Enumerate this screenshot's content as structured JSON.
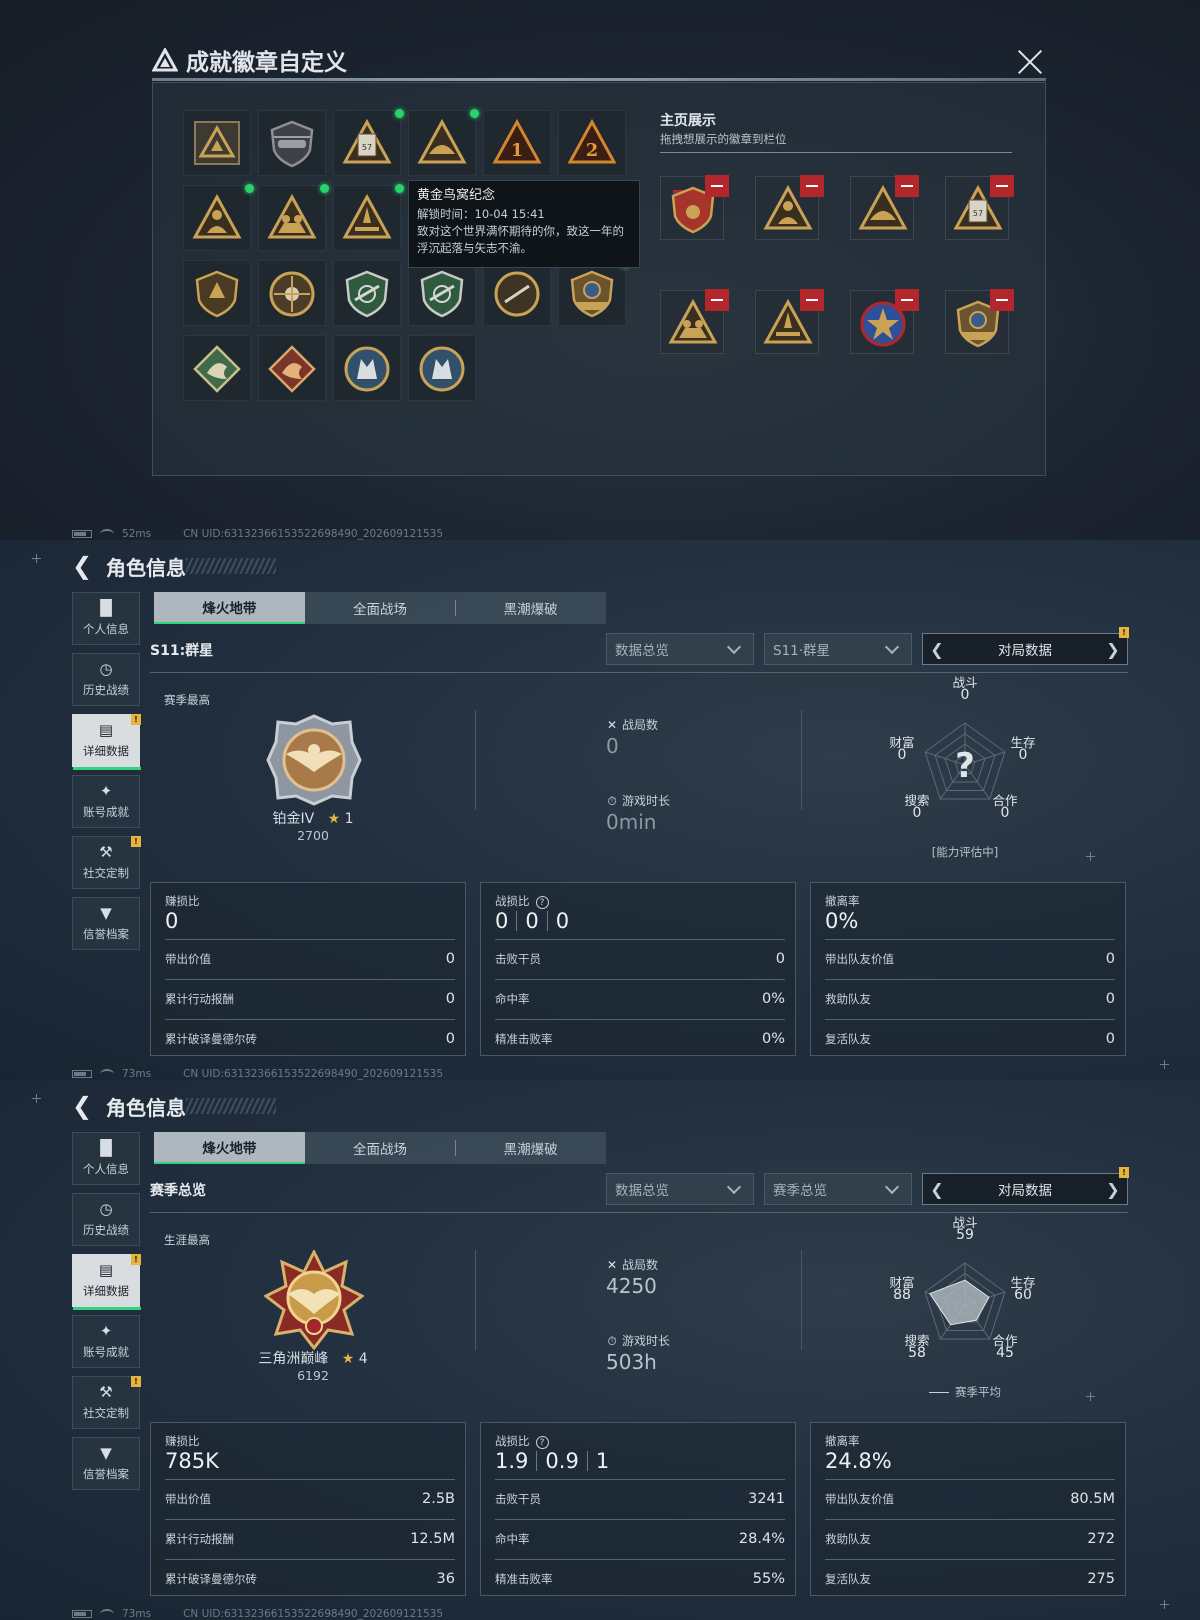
{
  "dialog": {
    "title": "成就徽章自定义",
    "tooltip": {
      "title": "黄金鸟窝纪念",
      "unlock": "解锁时间：10-04 15:41",
      "desc": "致对这个世界满怀期待的你，致这一年的浮沉起落与矢志不渝。"
    },
    "showcase_title": "主页展示",
    "showcase_sub": "拖拽想展示的徽章到栏位",
    "badges": [
      {
        "icon": "triangle-emblem-icon",
        "new": false
      },
      {
        "icon": "helicopter-badge-icon",
        "new": false
      },
      {
        "icon": "canister-badge-icon",
        "new": true,
        "text": "57"
      },
      {
        "icon": "helmet-badge-icon",
        "new": true
      },
      {
        "icon": "number-one-badge-icon",
        "new": false,
        "text": "1"
      },
      {
        "icon": "number-two-badge-icon",
        "new": false,
        "text": "2"
      },
      {
        "icon": "soldier-badge-icon",
        "new": true
      },
      {
        "icon": "squad-badge-icon",
        "new": true
      },
      {
        "icon": "rocket-badge-icon",
        "new": true
      },
      {
        "icon": "hidden-badge-icon",
        "new": false
      },
      {
        "icon": "hidden-badge-icon",
        "new": false
      },
      {
        "icon": "hidden-badge-icon",
        "new": true
      },
      {
        "icon": "shield-badge-icon",
        "new": false
      },
      {
        "icon": "skull-crosshair-badge-icon",
        "new": false
      },
      {
        "icon": "green-rifle-shield-icon",
        "new": false
      },
      {
        "icon": "green-rifle-shield-icon",
        "new": false
      },
      {
        "icon": "rifle-target-badge-icon",
        "new": false
      },
      {
        "icon": "golden-nest-badge-icon",
        "new": true
      },
      {
        "icon": "green-dragon-badge-icon",
        "new": false
      },
      {
        "icon": "red-dragon-badge-icon",
        "new": false
      },
      {
        "icon": "blue-wolf-badge-icon",
        "new": false
      },
      {
        "icon": "blue-wolf-badge-icon",
        "new": false
      }
    ],
    "showcase": [
      {
        "icon": "flag-shield-badge-icon"
      },
      {
        "icon": "soldier-badge-icon"
      },
      {
        "icon": "helmet-badge-icon"
      },
      {
        "icon": "canister-badge-icon",
        "text": "57"
      },
      {
        "icon": "squad-badge-icon"
      },
      {
        "icon": "rocket-badge-icon"
      },
      {
        "icon": "star-medal-badge-icon"
      },
      {
        "icon": "golden-nest-badge-icon"
      }
    ]
  },
  "status_bars": [
    {
      "ping": "52ms",
      "uid": "CN UID:631323661535226984​90_202609121535"
    },
    {
      "ping": "73ms",
      "uid": "CN UID:63132366153522698490_202609121535"
    },
    {
      "ping": "73ms",
      "uid": "CN UID:63132366153522698490_202609121535"
    }
  ],
  "pages": [
    {
      "title": "角色信息",
      "sidebar": [
        {
          "label": "个人信息",
          "icon": "bar-chart-icon",
          "warn": false,
          "active": false
        },
        {
          "label": "历史战绩",
          "icon": "clock-icon",
          "warn": false,
          "active": false
        },
        {
          "label": "详细数据",
          "icon": "folder-icon",
          "warn": true,
          "active": true
        },
        {
          "label": "账号成就",
          "icon": "medal-icon",
          "warn": false,
          "active": false
        },
        {
          "label": "社交定制",
          "icon": "tools-icon",
          "warn": true,
          "active": false
        },
        {
          "label": "信誉档案",
          "icon": "shield-chevron-icon",
          "warn": false,
          "active": false
        }
      ],
      "tabs": [
        "烽火地带",
        "全面战场",
        "黑潮爆破"
      ],
      "season_label": "S11:群星",
      "dropdown1": "数据总览",
      "dropdown2": "S11·群星",
      "pager_label": "对局数据",
      "best_label": "赛季最高",
      "rank": {
        "name": "铂金IV",
        "stars": "1",
        "points": "2700",
        "emblem": "platinum-eagle-emblem-icon"
      },
      "matches_label": "战局数",
      "matches_value": "0",
      "time_label": "游戏时长",
      "time_value": "0min",
      "radar": {
        "labels": [
          "战斗",
          "生存",
          "合作",
          "搜索",
          "财富"
        ],
        "values": [
          0,
          0,
          0,
          0,
          0
        ],
        "caption": "[能力评估中]",
        "pending": true
      },
      "boxes": [
        {
          "head": "赚损比",
          "value": [
            "0"
          ],
          "help": false,
          "rows": [
            {
              "k": "带出价值",
              "v": "0"
            },
            {
              "k": "累计行动报酬",
              "v": "0"
            },
            {
              "k": "累计破译曼德尔砖",
              "v": "0"
            }
          ]
        },
        {
          "head": "战损比",
          "value": [
            "0",
            "0",
            "0"
          ],
          "help": true,
          "rows": [
            {
              "k": "击败干员",
              "v": "0"
            },
            {
              "k": "命中率",
              "v": "0%"
            },
            {
              "k": "精准击败率",
              "v": "0%"
            }
          ]
        },
        {
          "head": "撤离率",
          "value": [
            "0%"
          ],
          "help": false,
          "rows": [
            {
              "k": "带出队友价值",
              "v": "0"
            },
            {
              "k": "救助队友",
              "v": "0"
            },
            {
              "k": "复活队友",
              "v": "0"
            }
          ]
        }
      ]
    },
    {
      "title": "角色信息",
      "sidebar": [
        {
          "label": "个人信息",
          "icon": "bar-chart-icon",
          "warn": false,
          "active": false
        },
        {
          "label": "历史战绩",
          "icon": "clock-icon",
          "warn": false,
          "active": false
        },
        {
          "label": "详细数据",
          "icon": "folder-icon",
          "warn": true,
          "active": true
        },
        {
          "label": "账号成就",
          "icon": "medal-icon",
          "warn": false,
          "active": false
        },
        {
          "label": "社交定制",
          "icon": "tools-icon",
          "warn": true,
          "active": false
        },
        {
          "label": "信誉档案",
          "icon": "shield-chevron-icon",
          "warn": false,
          "active": false
        }
      ],
      "tabs": [
        "烽火地带",
        "全面战场",
        "黑潮爆破"
      ],
      "season_label": "赛季总览",
      "dropdown1": "数据总览",
      "dropdown2": "赛季总览",
      "pager_label": "对局数据",
      "best_label": "生涯最高",
      "rank": {
        "name": "三角洲巅峰",
        "stars": "4",
        "points": "6192",
        "emblem": "delta-peak-emblem-icon"
      },
      "matches_label": "战局数",
      "matches_value": "4250",
      "time_label": "游戏时长",
      "time_value": "503h",
      "radar": {
        "labels": [
          "战斗",
          "生存",
          "合作",
          "搜索",
          "财富"
        ],
        "values": [
          59,
          60,
          45,
          58,
          88
        ],
        "caption": "赛季平均",
        "pending": false
      },
      "boxes": [
        {
          "head": "赚损比",
          "value": [
            "785K"
          ],
          "help": false,
          "rows": [
            {
              "k": "带出价值",
              "v": "2.5B"
            },
            {
              "k": "累计行动报酬",
              "v": "12.5M"
            },
            {
              "k": "累计破译曼德尔砖",
              "v": "36"
            }
          ]
        },
        {
          "head": "战损比",
          "value": [
            "1.9",
            "0.9",
            "1"
          ],
          "help": true,
          "rows": [
            {
              "k": "击败干员",
              "v": "3241"
            },
            {
              "k": "命中率",
              "v": "28.4%"
            },
            {
              "k": "精准击败率",
              "v": "55%"
            }
          ]
        },
        {
          "head": "撤离率",
          "value": [
            "24.8%"
          ],
          "help": false,
          "rows": [
            {
              "k": "带出队友价值",
              "v": "80.5M"
            },
            {
              "k": "救助队友",
              "v": "272"
            },
            {
              "k": "复活队友",
              "v": "275"
            }
          ]
        }
      ]
    }
  ],
  "colors": {
    "accent_green": "#2fd37a",
    "remove_red": "#b3262c",
    "warn_yellow": "#e8b33a",
    "gold": "#c9a255"
  }
}
